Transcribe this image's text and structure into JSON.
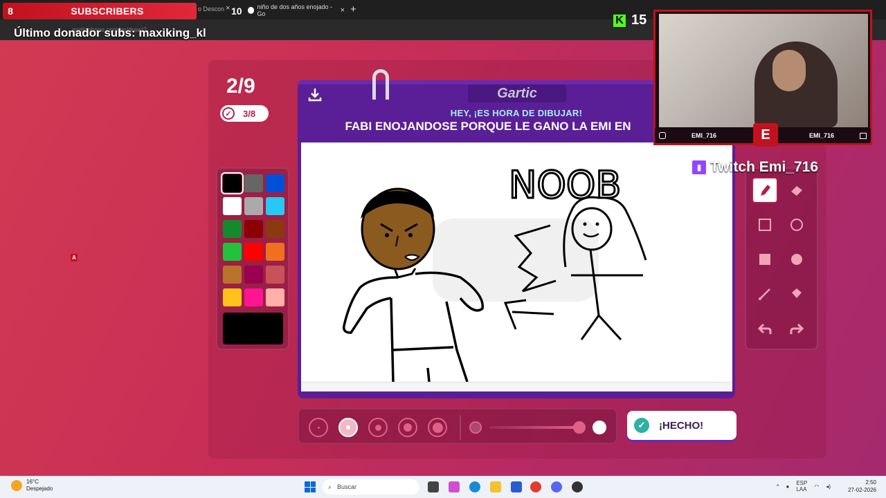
{
  "browser": {
    "sub_count": "8",
    "sub_label": "SUBSCRIBERS",
    "tab_fragment": "o Descon",
    "tab_close": "×",
    "count_badge": "10",
    "tab2_title": "niño de dos años enojado - Go",
    "new_tab": "+",
    "url": "garticphone.com/es/draw/2"
  },
  "overlay": {
    "donor_text": "Último donador subs: maxiking_kl",
    "kick_count": "15",
    "twitch_handle": "Twitch Emi_716",
    "cam_left_name": "EMI_716",
    "cam_right_name": "EMI_716",
    "cam_logo": "E",
    "marker": "A"
  },
  "game": {
    "round": "2/9",
    "progress": "3/8",
    "logo": "Gartic",
    "prompt_sub": "HEY, ¡ES HORA DE DIBUJAR!",
    "prompt": "FABI ENOJANDOSE PORQUE LE GANO LA EMI EN",
    "drawing_text": "NOOB",
    "done_label": "¡HECHO!",
    "selected_color": "#000000",
    "colors": [
      "#000000",
      "#666666",
      "#0050d8",
      "#ffffff",
      "#aaaaaa",
      "#26c8f5",
      "#158a2d",
      "#8b0000",
      "#8b3a10",
      "#23c13c",
      "#ff0000",
      "#f07020",
      "#b8742a",
      "#99004f",
      "#c8525a",
      "#ffc21a",
      "#ff1493",
      "#ffb0a8"
    ],
    "selected_size_index": 1,
    "tools": [
      "pencil-icon",
      "eraser-icon",
      "rect-outline-icon",
      "circle-outline-icon",
      "rect-fill-icon",
      "circle-fill-icon",
      "line-icon",
      "bucket-icon",
      "undo-icon",
      "redo-icon"
    ]
  },
  "taskbar": {
    "temp": "16°C",
    "weather": "Despejado",
    "search": "Buscar",
    "lang1": "ESP",
    "lang2": "LAA",
    "time": "2:50",
    "date": "27-02-2026"
  }
}
